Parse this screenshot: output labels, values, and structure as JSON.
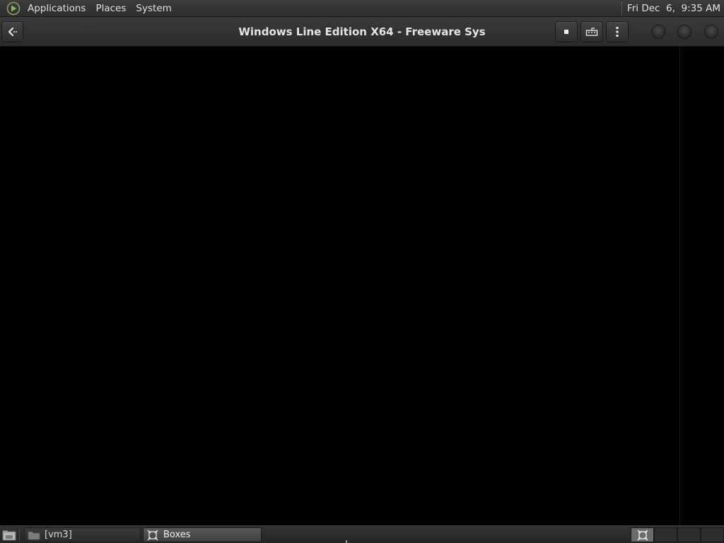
{
  "top_panel": {
    "menus": [
      "Applications",
      "Places",
      "System"
    ],
    "clock": "Fri Dec  6,  9:35 AM"
  },
  "window": {
    "title": "Windows Line Edition X64 - Freeware Sys",
    "buttons": {
      "back": "back-arrow-icon",
      "stop": "stop-icon",
      "send_keys": "keyboard-icon",
      "menu": "vertical-dots-icon"
    }
  },
  "taskbar": {
    "tasks": [
      {
        "label": "[vm3]",
        "icon": "folder-icon",
        "active": false
      },
      {
        "label": "Boxes",
        "icon": "boxes-icon",
        "active": true
      }
    ],
    "workspaces": 4,
    "active_workspace": 1
  },
  "colors": {
    "panel": "#2e2e2e",
    "display": "#000000",
    "accent": "#6b6b6b"
  }
}
